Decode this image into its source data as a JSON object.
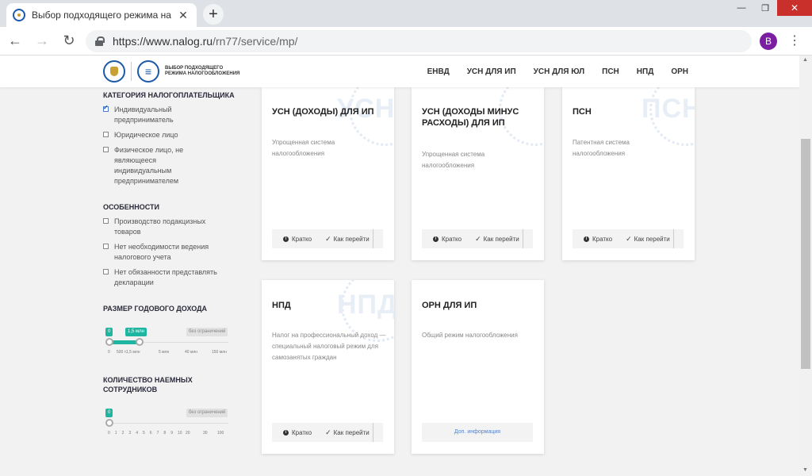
{
  "browser": {
    "tab_title": "Выбор подходящего режима на",
    "tab_close": "✕",
    "new_tab": "+",
    "url_host": "https://www.nalog.ru",
    "url_path": "/rn77/service/mp/",
    "profile_letter": "B",
    "menu": "⋮",
    "min": "—",
    "max": "❐",
    "close": "✕"
  },
  "header": {
    "logo_text_line1": "Выбор подходящего",
    "logo_text_line2": "режима налогообложения",
    "nav": [
      "ЕНВД",
      "УСН ДЛЯ ИП",
      "УСН ДЛЯ ЮЛ",
      "ПСН",
      "НПД",
      "ОРН"
    ]
  },
  "filters": {
    "category": {
      "heading": "Категория налогоплательщика",
      "options": [
        {
          "label": "Индивидуальный предприниматель",
          "checked": true
        },
        {
          "label": "Юридическое лицо",
          "checked": false
        },
        {
          "label": "Физическое лицо, не являющееся индивидуальным предпринимателем",
          "checked": false
        }
      ]
    },
    "features": {
      "heading": "Особенности",
      "options": [
        {
          "label": "Производство подакцизных товаров",
          "checked": false
        },
        {
          "label": "Нет необходимости ведения налогового учета",
          "checked": false
        },
        {
          "label": "Нет обязанности представлять декларации",
          "checked": false
        }
      ]
    },
    "income": {
      "heading": "Размер годового дохода",
      "min_chip": "0",
      "max_chip": "1,5 млн",
      "limit_chip": "без ограничений",
      "ticks": [
        "0",
        "500 т.",
        "1,5 млн",
        "5 млн",
        "40 млн",
        "150 млн"
      ],
      "range_fraction": [
        0,
        0.25
      ]
    },
    "employees": {
      "heading": "Количество наемных сотрудников",
      "value_chip": "0",
      "limit_chip": "без ограничений",
      "ticks": [
        "0",
        "1",
        "2",
        "3",
        "4",
        "5",
        "6",
        "7",
        "8",
        "9",
        "10",
        "20",
        "30",
        "100"
      ],
      "value_fraction": 0
    }
  },
  "cards": [
    {
      "title": "УСН (ДОХОДЫ) ДЛЯ ИП",
      "watermark": "УСН",
      "desc": "Упрощенная система налогообложения",
      "brief": "Кратко",
      "go": "Как перейти"
    },
    {
      "title": "УСН (ДОХОДЫ МИНУС РАСХОДЫ) ДЛЯ ИП",
      "watermark": "",
      "desc": "Упрощенная система налогообложения",
      "brief": "Кратко",
      "go": "Как перейти"
    },
    {
      "title": "ПСН",
      "watermark": "ПСН",
      "desc": "Патентная система налогообложения",
      "brief": "Кратко",
      "go": "Как перейти"
    },
    {
      "title": "НПД",
      "watermark": "НПД",
      "desc": "Налог на профессиональный доход — специальный налоговый режим для самозанятых граждан",
      "brief": "Кратко",
      "go": "Как перейти"
    },
    {
      "title": "ОРН ДЛЯ ИП",
      "watermark": "",
      "desc": "Общий режим налогообложения",
      "more": "Доп. информация"
    }
  ]
}
